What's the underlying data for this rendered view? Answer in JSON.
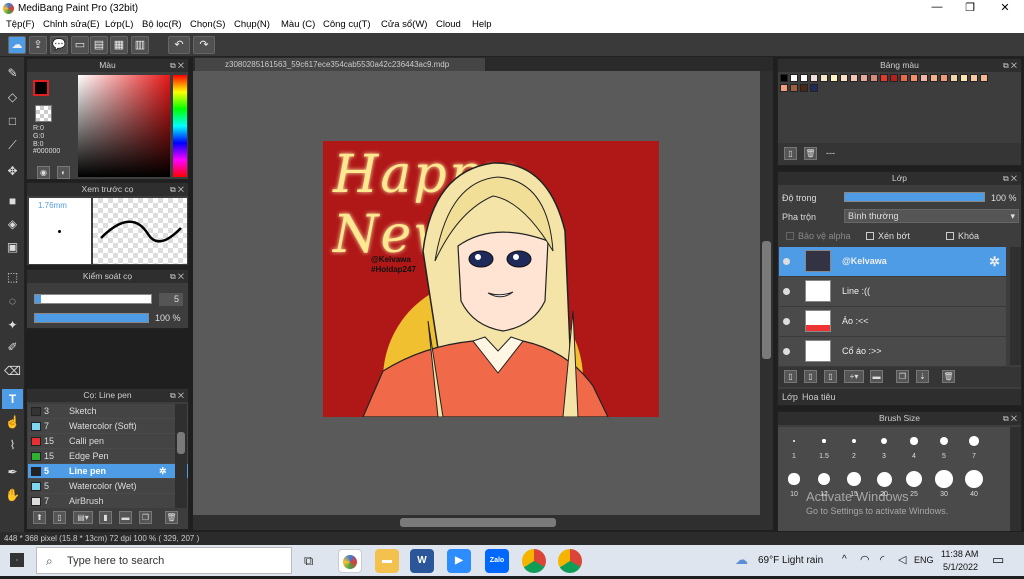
{
  "window": {
    "title": "MediBang Paint Pro (32bit)",
    "min": "—",
    "max": "❐",
    "close": "✕"
  },
  "menu": [
    "Tệp(F)",
    "Chỉnh sửa(E)",
    "Lớp(L)",
    "Bộ lọc(R)",
    "Chọn(S)",
    "Chụp(N)",
    "Màu (C)",
    "Công cụ(T)",
    "Cửa sổ(W)",
    "Cloud",
    "Help"
  ],
  "document_tab": "z3080285161563_59c617ece354cab5530a42c236443ac9.mdp",
  "panels": {
    "color": {
      "title": "Màu",
      "r": "R:0",
      "g": "G:0",
      "b": "B:0",
      "hex": "#000000"
    },
    "preview": {
      "title": "Xem trước cọ",
      "size": "1.76mm"
    },
    "control": {
      "title": "Kiểm soát cọ",
      "size_value": "5",
      "opacity_value": "100 %",
      "size_fraction": 0.05,
      "opacity_fraction": 1.0
    },
    "brush": {
      "title": "Cọ: Line pen",
      "items": [
        {
          "size": "3",
          "name": "Sketch",
          "color": "#333333"
        },
        {
          "size": "7",
          "name": "Watercolor (Soft)",
          "color": "#7fd4f0"
        },
        {
          "size": "15",
          "name": "Calli pen",
          "color": "#e83030"
        },
        {
          "size": "15",
          "name": "Edge Pen",
          "color": "#30b030"
        },
        {
          "size": "5",
          "name": "Line pen",
          "color": "#222222"
        },
        {
          "size": "5",
          "name": "Watercolor (Wet)",
          "color": "#7fd4f0"
        },
        {
          "size": "7",
          "name": "AirBrush",
          "color": "#dddddd"
        }
      ],
      "selected_index": 4
    },
    "palette": {
      "title": "Bảng màu",
      "footer": "---"
    },
    "layers": {
      "title": "Lớp",
      "opacity_label": "Độ trong",
      "opacity_value": "100 %",
      "blend_label": "Pha trộn",
      "blend_value": "Bình thường",
      "protect_alpha": "Bảo vệ alpha",
      "clipping": "Xén bớt",
      "lock": "Khóa",
      "items": [
        "@Kelvawa",
        "Line :((",
        "Áo :<<",
        "Cổ áo :>>"
      ],
      "tab1": "Lớp",
      "tab2": "Hoa tiêu"
    },
    "brushsize": {
      "title": "Brush Size",
      "row1": [
        "1",
        "1.5",
        "2",
        "3",
        "4",
        "5",
        "7"
      ],
      "row2": [
        "10",
        "12",
        "15",
        "20",
        "25",
        "30",
        "40"
      ]
    }
  },
  "artwork": {
    "text": "Happy New",
    "watermark1": "@Kelvawa",
    "watermark2": "#Holdap247"
  },
  "status": "448 * 368 pixel   (15.8 * 13cm)   72 dpi   100 %   ( 329, 207 )",
  "activate": {
    "line1": "Activate Windows",
    "line2": "Go to Settings to activate Windows."
  },
  "taskbar": {
    "search": "Type here to search",
    "weather": "69°F  Light rain",
    "lang": "ENG",
    "time": "11:38 AM",
    "date": "5/1/2022"
  },
  "colors": {
    "accent": "#4e9be6",
    "canvas_bg": "#b01818"
  }
}
